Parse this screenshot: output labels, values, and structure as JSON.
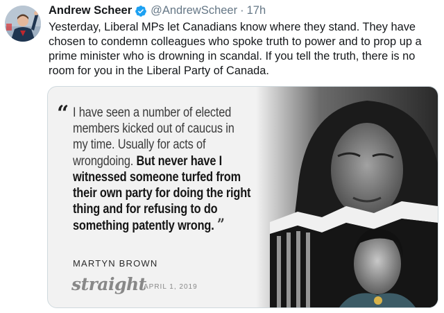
{
  "tweet": {
    "display_name": "Andrew Scheer",
    "handle": "@AndrewScheer",
    "separator": "·",
    "time": "17h",
    "text": "Yesterday, Liberal MPs let Canadians know where they stand. They have chosen to condemn colleagues who spoke truth to power and to prop up a prime minister who is drowning in scandal. If you tell the truth, there is no room for you in the Liberal Party of Canada.",
    "icons": {
      "verified": "verified-badge-icon"
    },
    "colors": {
      "verified": "#1da1f2",
      "meta_text": "#657786"
    }
  },
  "media": {
    "quote_open": "“",
    "quote_light": "I have seen a number of elected members kicked out of caucus in my time. Usually for acts of wrongdoing.",
    "quote_bold": "But never have I witnessed someone turfed from their own party for doing the right thing and for refusing to do something patently wrong.",
    "quote_close": "”",
    "author": "MARTYN BROWN",
    "publication": "straight",
    "date": "APRIL 1, 2019"
  }
}
